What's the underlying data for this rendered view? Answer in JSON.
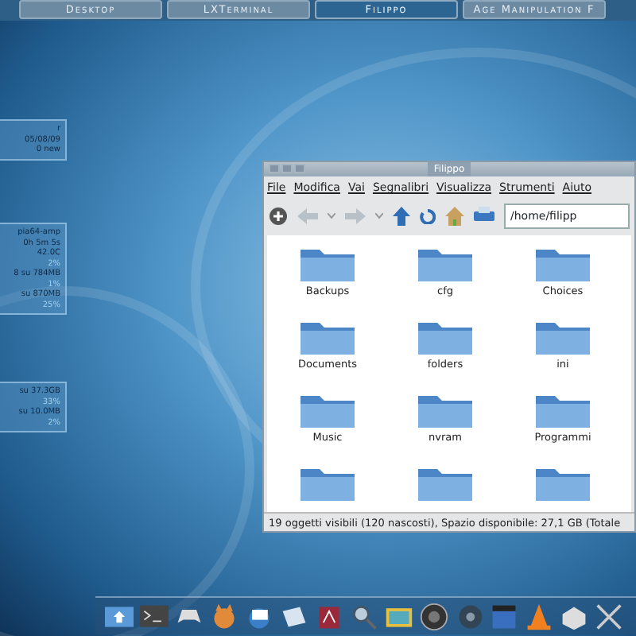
{
  "taskbar": {
    "buttons": [
      {
        "label": "Desktop",
        "selected": false
      },
      {
        "label": "LXTerminal",
        "selected": false
      },
      {
        "label": "Filippo",
        "selected": true
      },
      {
        "label": "Age Manipulation F",
        "selected": false
      }
    ]
  },
  "widgets": [
    {
      "lines": [
        {
          "text": "r",
          "kind": "main"
        },
        {
          "text": "05/08/09",
          "kind": "main"
        },
        {
          "text": "0 new",
          "kind": "main"
        }
      ]
    },
    {
      "lines": [
        {
          "text": "pia64-amp",
          "kind": "main"
        },
        {
          "text": "0h 5m 5s",
          "kind": "main"
        },
        {
          "text": "42.0C",
          "kind": "main"
        },
        {
          "text": "2%",
          "kind": "dim"
        },
        {
          "text": "8 su 784MB",
          "kind": "main"
        },
        {
          "text": "1%",
          "kind": "dim"
        },
        {
          "text": "su 870MB",
          "kind": "main"
        },
        {
          "text": "25%",
          "kind": "dim"
        }
      ]
    },
    {
      "lines": [
        {
          "text": "su 37.3GB",
          "kind": "main"
        },
        {
          "text": "33%",
          "kind": "dim"
        },
        {
          "text": "su 10.0MB",
          "kind": "main"
        },
        {
          "text": "2%",
          "kind": "dim"
        }
      ]
    }
  ],
  "window": {
    "title": "Filippo",
    "menu": [
      "File",
      "Modifica",
      "Vai",
      "Segnalibri",
      "Visualizza",
      "Strumenti",
      "Aiuto"
    ],
    "path": "/home/filipp",
    "folders": [
      "Backups",
      "cfg",
      "Choices",
      "Documents",
      "folders",
      "ini",
      "Music",
      "nvram",
      "Programmi"
    ],
    "status_bar": "19 oggetti visibili (120 nascosti), Spazio disponibile: 27,1 GB (Totale"
  }
}
